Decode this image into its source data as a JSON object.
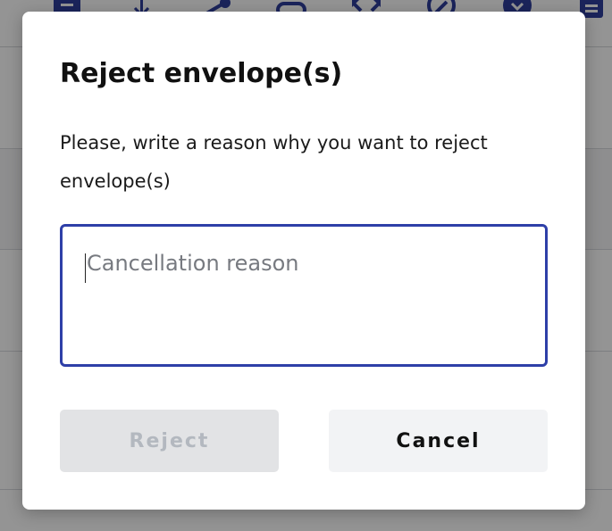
{
  "background": {
    "toolbar_icons": [
      "document-icon",
      "download-icon",
      "share-icon",
      "link-icon",
      "expand-icon",
      "refresh-icon",
      "close-circle-icon",
      "list-icon"
    ]
  },
  "dialog": {
    "title": "Reject envelope(s)",
    "message": "Please, write a reason why you want to reject envelope(s)",
    "reason_placeholder": "Cancellation reason",
    "reason_value": "",
    "reject_label": "Reject",
    "reject_enabled": false,
    "cancel_label": "Cancel"
  },
  "colors": {
    "field_border": "#2e3fa8",
    "reject_bg_disabled": "#e2e3e5",
    "reject_text_disabled": "#b3b8bf",
    "cancel_bg": "#f2f3f5",
    "overlay": "rgba(0,0,0,0.42)"
  }
}
